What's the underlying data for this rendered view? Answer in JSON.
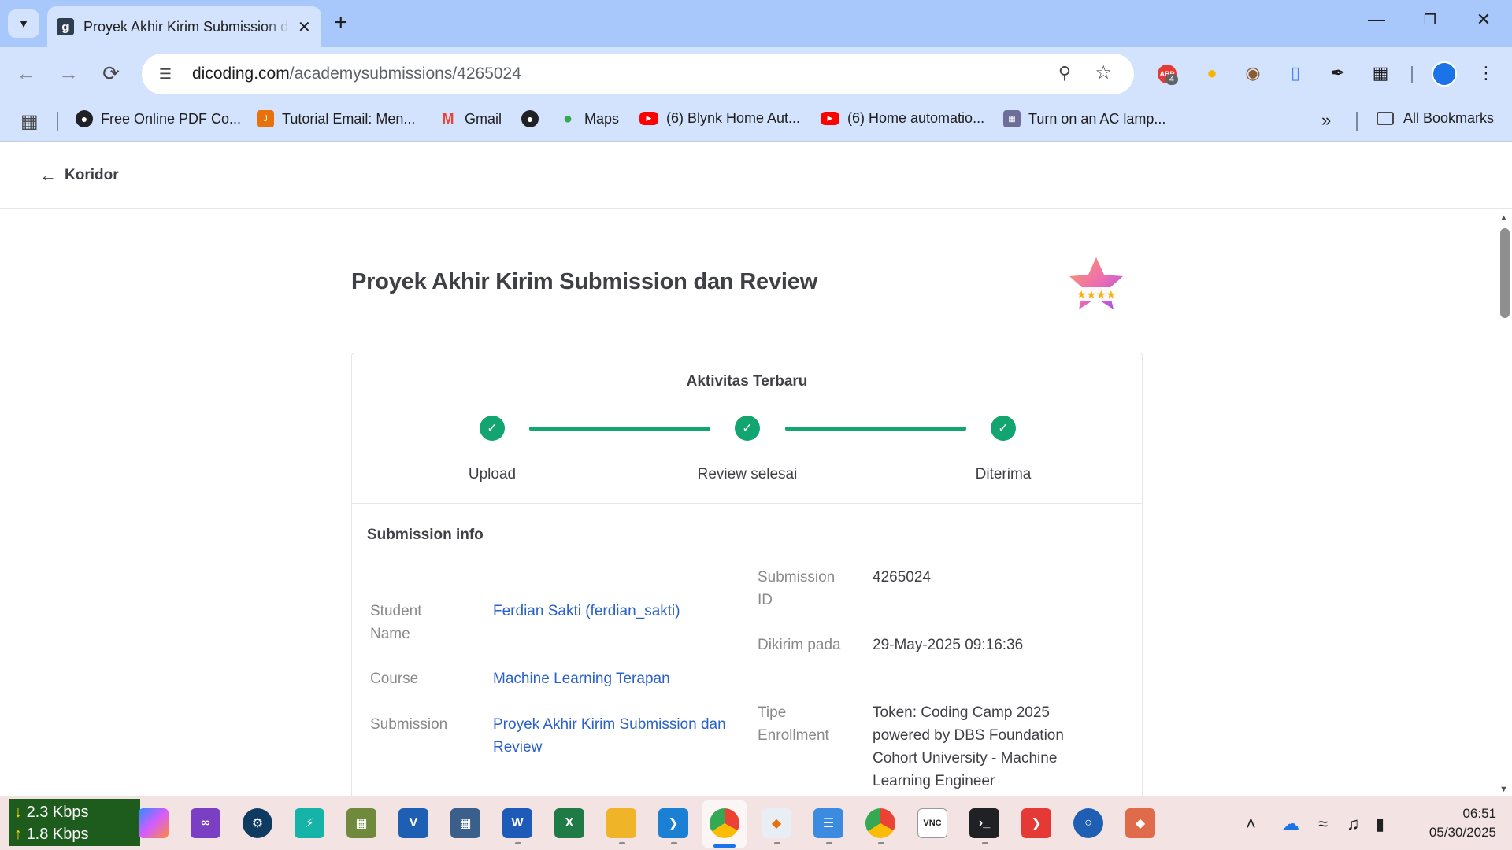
{
  "browser": {
    "tab_title": "Proyek Akhir Kirim Submission dan Review",
    "favicon_letter": "g",
    "url_domain": "dicoding.com",
    "url_path": "/academysubmissions/4265024",
    "extension_badge": "4",
    "extension_abp_label": "ABP",
    "bookmarks": [
      {
        "label": "Free Online PDF Co...",
        "icon": "globe-icon"
      },
      {
        "label": "Tutorial Email: Men...",
        "icon": "orange-site-icon"
      },
      {
        "label": "Gmail",
        "icon": "gmail-icon"
      },
      {
        "label": "",
        "icon": "globe-icon"
      },
      {
        "label": "Maps",
        "icon": "maps-icon"
      },
      {
        "label": "(6) Blynk Home Aut...",
        "icon": "youtube-icon"
      },
      {
        "label": "(6) Home automatio...",
        "icon": "youtube-icon"
      },
      {
        "label": "Turn on an AC lamp...",
        "icon": "iot-icon"
      }
    ],
    "all_bookmarks_label": "All Bookmarks"
  },
  "page": {
    "back_label": "Koridor",
    "title": "Proyek Akhir Kirim Submission dan Review",
    "activity_title": "Aktivitas Terbaru",
    "steps": [
      "Upload",
      "Review selesai",
      "Diterima"
    ],
    "info_heading": "Submission info",
    "fields": {
      "student_name_label": "Student Name",
      "student_name_value": "Ferdian Sakti (ferdian_sakti)",
      "course_label": "Course",
      "course_value": "Machine Learning Terapan",
      "submission_label": "Submission",
      "submission_value": "Proyek Akhir Kirim Submission dan Review",
      "submission_id_label": "Submission ID",
      "submission_id_value": "4265024",
      "dikirim_label": "Dikirim pada",
      "dikirim_value": "29-May-2025 09:16:36",
      "tipe_label": "Tipe Enrollment",
      "tipe_value": "Token: Coding Camp 2025 powered by DBS Foundation Cohort University - Machine Learning Engineer"
    }
  },
  "taskbar": {
    "net_down": "2.3 Kbps",
    "net_up": "1.8 Kbps",
    "time": "06:51",
    "date": "05/30/2025"
  },
  "colors": {
    "accent": "#12a570",
    "link": "#2b62c9",
    "chrome_tabbar": "#a8c7fa",
    "chrome_toolbar": "#d3e3fd"
  }
}
